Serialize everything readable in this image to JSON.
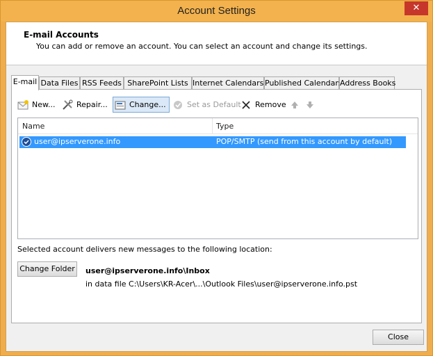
{
  "window": {
    "title": "Account Settings",
    "close_glyph": "✕"
  },
  "header": {
    "title": "E-mail Accounts",
    "subtitle": "You can add or remove an account. You can select an account and change its settings."
  },
  "tabs": [
    {
      "label": "E-mail",
      "active": true
    },
    {
      "label": "Data Files"
    },
    {
      "label": "RSS Feeds"
    },
    {
      "label": "SharePoint Lists"
    },
    {
      "label": "Internet Calendars"
    },
    {
      "label": "Published Calendars"
    },
    {
      "label": "Address Books"
    }
  ],
  "toolbar": {
    "new_label": "New...",
    "repair_label": "Repair...",
    "change_label": "Change...",
    "set_default_label": "Set as Default",
    "remove_label": "Remove"
  },
  "accounts": {
    "columns": [
      "Name",
      "Type"
    ],
    "rows": [
      {
        "name": "user@ipserverone.info",
        "type": "POP/SMTP (send from this account by default)",
        "selected": true
      }
    ]
  },
  "delivery": {
    "label": "Selected account delivers new messages to the following location:",
    "change_folder_label": "Change Folder",
    "folder_path": "user@ipserverone.info\\Inbox",
    "data_file": "in data file C:\\Users\\KR-Acer\\...\\Outlook Files\\user@ipserverone.info.pst"
  },
  "footer": {
    "close_label": "Close"
  },
  "colors": {
    "selection": "#3399ff",
    "title_bar": "#f3b24d",
    "close_x": "#c7362b"
  }
}
